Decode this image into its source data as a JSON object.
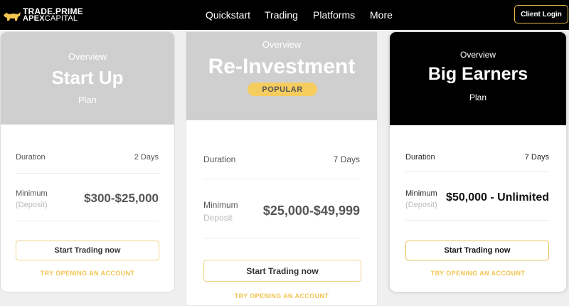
{
  "brand": {
    "line1": "TRADE.PRIME",
    "line2_bold": "APEX",
    "line2_light": "CAPITAL",
    "accent": "#f2c451"
  },
  "nav": {
    "items": [
      "Quickstart",
      "Trading",
      "Platforms",
      "More"
    ],
    "client_login": "Client Login"
  },
  "plans": [
    {
      "overview": "Overview",
      "name": "Start Up",
      "plan": "Plan",
      "duration_label": "Duration",
      "duration": "2 Days",
      "min_label": "Minimum",
      "min_sub": "(Deposit)",
      "amount": "$300-$25,000",
      "cta": "Start Trading now",
      "try": "TRY OPENING AN ACCOUNT"
    },
    {
      "overview": "Overview",
      "name": "Re-Investment",
      "badge": "POPULAR",
      "duration_label": "Duration",
      "duration": "7 Days",
      "min_label": "Minimum",
      "min_sub": "Deposit",
      "amount": "$25,000-$49,999",
      "cta": "Start Trading now",
      "try": "TRY OPENING AN ACCOUNT"
    },
    {
      "overview": "Overview",
      "name": "Big Earners",
      "plan": "Plan",
      "duration_label": "Duration",
      "duration": "7 Days",
      "min_label": "Minimum",
      "min_sub": "(Deposit)",
      "amount": "$50,000 - Unlimited",
      "cta": "Start Trading now",
      "try": "TRY OPENING AN ACCOUNT"
    }
  ]
}
